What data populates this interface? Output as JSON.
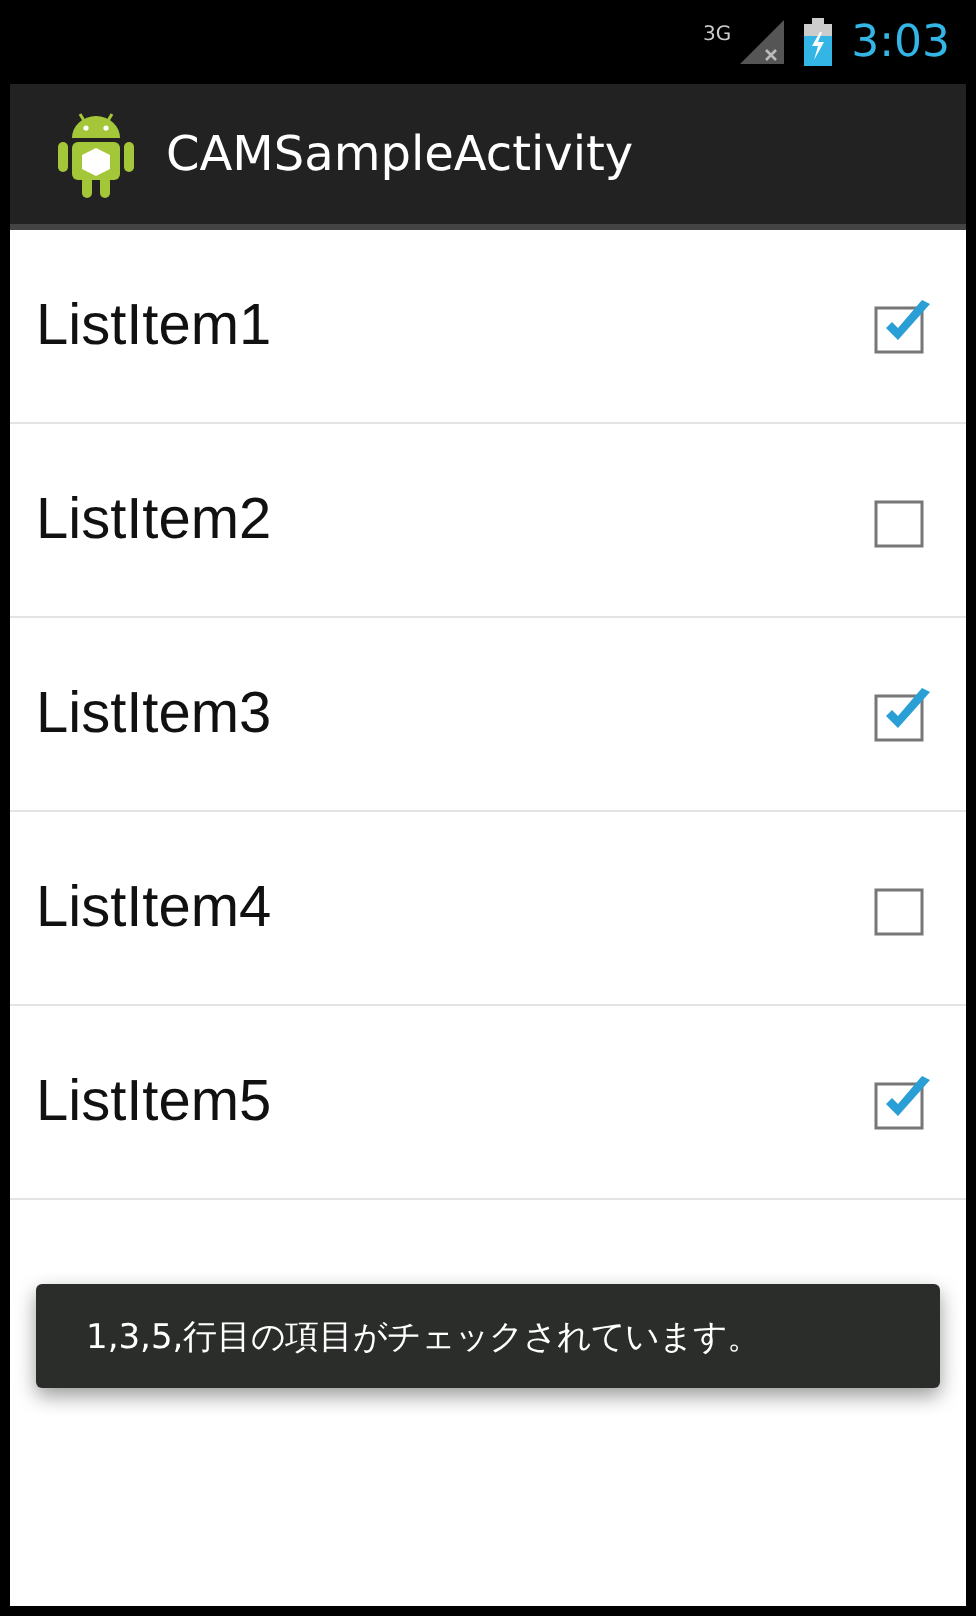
{
  "status_bar": {
    "network": "3G",
    "time": "3:03"
  },
  "action_bar": {
    "title": "CAMSampleActivity"
  },
  "list": [
    {
      "label": "ListItem1",
      "checked": true
    },
    {
      "label": "ListItem2",
      "checked": false
    },
    {
      "label": "ListItem3",
      "checked": true
    },
    {
      "label": "ListItem4",
      "checked": false
    },
    {
      "label": "ListItem5",
      "checked": true
    }
  ],
  "toast": {
    "text": "1,3,5,行目の項目がチェックされています。"
  }
}
